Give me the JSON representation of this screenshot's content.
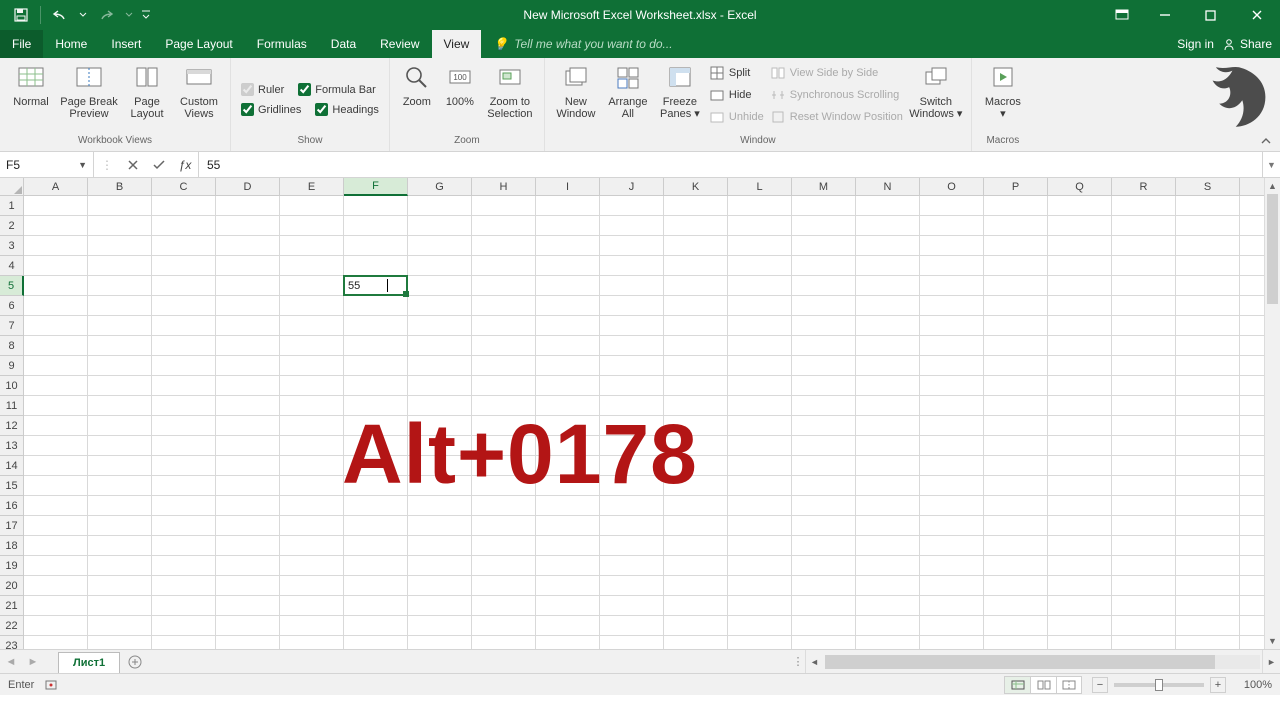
{
  "title": "New Microsoft Excel Worksheet.xlsx - Excel",
  "tabs": {
    "file": "File",
    "home": "Home",
    "insert": "Insert",
    "pageLayout": "Page Layout",
    "formulas": "Formulas",
    "data": "Data",
    "review": "Review",
    "view": "View"
  },
  "tellme": "Tell me what you want to do...",
  "signin": "Sign in",
  "share": "Share",
  "ribbon": {
    "workbookViews": {
      "label": "Workbook Views",
      "normal": "Normal",
      "pageBreak": "Page Break\nPreview",
      "pageLayout": "Page\nLayout",
      "custom": "Custom\nViews"
    },
    "show": {
      "label": "Show",
      "ruler": "Ruler",
      "formulaBar": "Formula Bar",
      "gridlines": "Gridlines",
      "headings": "Headings"
    },
    "zoom": {
      "label": "Zoom",
      "zoom": "Zoom",
      "hundred": "100%",
      "zoomToSel": "Zoom to\nSelection"
    },
    "window": {
      "label": "Window",
      "newWindow": "New\nWindow",
      "arrangeAll": "Arrange\nAll",
      "freeze": "Freeze\nPanes",
      "split": "Split",
      "hide": "Hide",
      "unhide": "Unhide",
      "sideBySide": "View Side by Side",
      "syncScroll": "Synchronous Scrolling",
      "resetPos": "Reset Window Position",
      "switch": "Switch\nWindows"
    },
    "macros": {
      "label": "Macros",
      "macros": "Macros"
    }
  },
  "namebox": "F5",
  "formula": "55",
  "columns": [
    "A",
    "B",
    "C",
    "D",
    "E",
    "F",
    "G",
    "H",
    "I",
    "J",
    "K",
    "L",
    "M",
    "N",
    "O",
    "P",
    "Q",
    "R",
    "S"
  ],
  "rows": [
    "1",
    "2",
    "3",
    "4",
    "5",
    "6",
    "7",
    "8",
    "9",
    "10",
    "11",
    "12",
    "13",
    "14",
    "15",
    "16",
    "17",
    "18",
    "19",
    "20",
    "21",
    "22",
    "23"
  ],
  "activeCol": "F",
  "activeRow": "5",
  "cellValue": "55",
  "overlay": "Alt+0178",
  "sheet": "Лист1",
  "statusMode": "Enter",
  "zoomPct": "100%"
}
